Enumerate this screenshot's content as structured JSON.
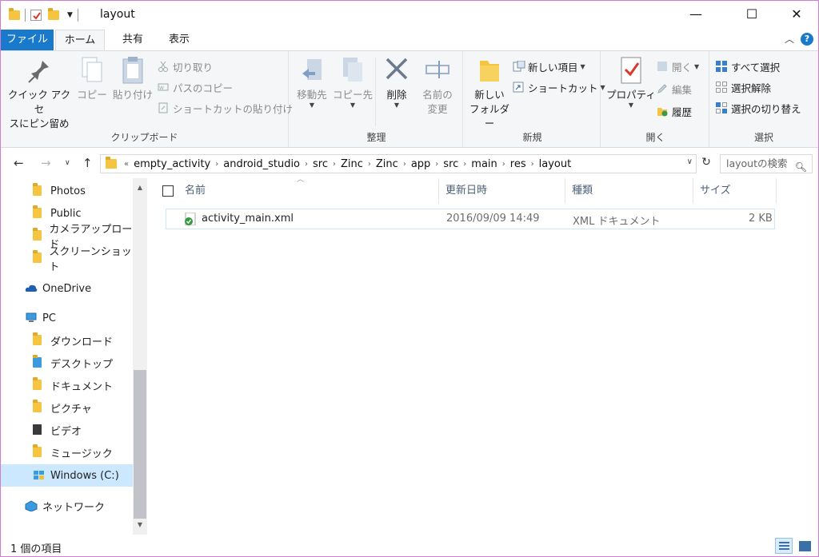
{
  "window": {
    "title": "layout",
    "minimize": "—",
    "maximize": "☐",
    "close": "✕"
  },
  "tabs": [
    {
      "label": "ファイル"
    },
    {
      "label": "ホーム"
    },
    {
      "label": "共有"
    },
    {
      "label": "表示"
    }
  ],
  "help": "?",
  "ribbon": {
    "clipboard": {
      "label": "クリップボード",
      "pin_l1": "クイック アクセ",
      "pin_l2": "スにピン留め",
      "copy": "コピー",
      "paste": "貼り付け",
      "cut": "切り取り",
      "copy_path": "パスのコピー",
      "paste_shortcut": "ショートカットの貼り付け"
    },
    "organize": {
      "label": "整理",
      "move_to": "移動先",
      "copy_to": "コピー先",
      "delete": "削除",
      "rename_l1": "名前の",
      "rename_l2": "変更"
    },
    "new": {
      "label": "新規",
      "new_folder_l1": "新しい",
      "new_folder_l2": "フォルダー",
      "new_item": "新しい項目",
      "shortcut": "ショートカット"
    },
    "open": {
      "label": "開く",
      "properties": "プロパティ",
      "open": "開く",
      "edit": "編集",
      "history": "履歴"
    },
    "select": {
      "label": "選択",
      "select_all": "すべて選択",
      "select_none": "選択解除",
      "invert": "選択の切り替え"
    }
  },
  "address": {
    "overflow": "«",
    "crumbs": [
      "empty_activity",
      "android_studio",
      "src",
      "Zinc",
      "Zinc",
      "app",
      "src",
      "main",
      "res",
      "layout"
    ],
    "search_placeholder": "layoutの検索"
  },
  "nav": [
    {
      "label": "Photos"
    },
    {
      "label": "Public"
    },
    {
      "label": "カメラアップロード"
    },
    {
      "label": "スクリーンショット"
    },
    {
      "label": "OneDrive"
    },
    {
      "label": "PC"
    },
    {
      "label": "ダウンロード"
    },
    {
      "label": "デスクトップ"
    },
    {
      "label": "ドキュメント"
    },
    {
      "label": "ピクチャ"
    },
    {
      "label": "ビデオ"
    },
    {
      "label": "ミュージック"
    },
    {
      "label": "Windows (C:)"
    },
    {
      "label": "ネットワーク"
    }
  ],
  "columns": {
    "name": "名前",
    "modified": "更新日時",
    "type": "種類",
    "size": "サイズ"
  },
  "files": [
    {
      "name": "activity_main.xml",
      "modified": "2016/09/09 14:49",
      "type": "XML ドキュメント",
      "size": "2 KB"
    }
  ],
  "status": {
    "count": "1 個の項目"
  },
  "colors": {
    "accent": "#1979ca",
    "selection": "#cce8ff",
    "window_border": "#d17bd1"
  }
}
